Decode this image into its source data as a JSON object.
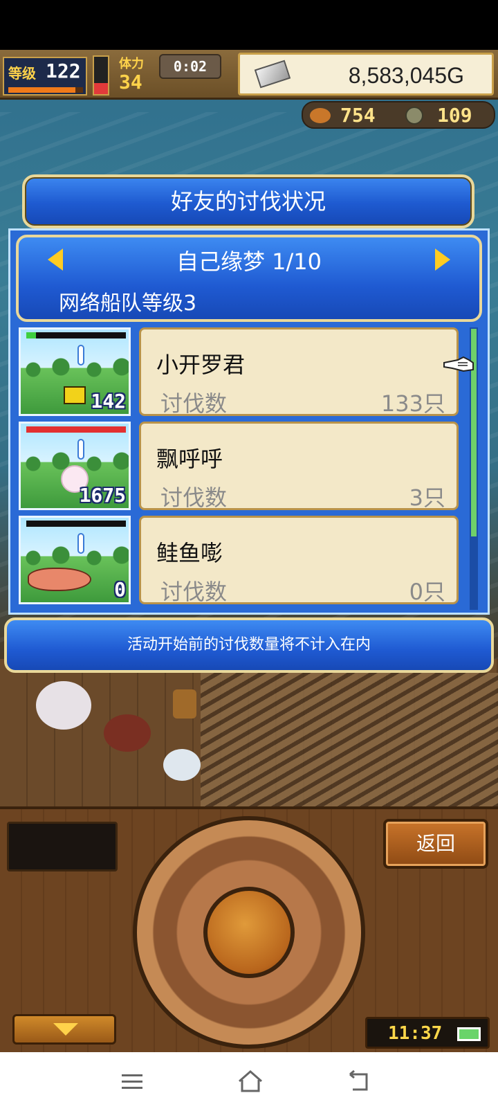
{
  "hud": {
    "level_label": "等级",
    "level_value": "122",
    "level_progress": 0.9,
    "hp_level": 0.3,
    "stamina_label": "体力",
    "stamina_value": "34",
    "timer": "0:02",
    "gold": "8,583,045G",
    "food": "754",
    "coins": "109"
  },
  "dialog": {
    "title": "好友的讨伐状况",
    "friend_name": "自己缘梦 1/10",
    "fleet_level": "网络船队等级3",
    "entries": [
      {
        "name": "小开罗君",
        "kill_label": "讨伐数",
        "kill_value": "133只",
        "thumb_count": "142",
        "hp_fraction": 0.1,
        "hp_color": "#3fcf3f",
        "monster_icon": "yellow-creature-icon"
      },
      {
        "name": "飘呼呼",
        "kill_label": "讨伐数",
        "kill_value": "3只",
        "thumb_count": "1675",
        "hp_fraction": 1.0,
        "hp_color": "#e23030",
        "monster_icon": "ghost-icon"
      },
      {
        "name": "鲑鱼嘭",
        "kill_label": "讨伐数",
        "kill_value": "0只",
        "thumb_count": "0",
        "hp_fraction": 0.0,
        "hp_color": "#e23030",
        "monster_icon": "salmon-icon"
      }
    ]
  },
  "notice": "活动开始前的讨伐数量将不计入在内",
  "controls": {
    "back_label": "返回",
    "clock": "11:37"
  },
  "colors": {
    "panel_blue": "#1f5ad2",
    "card_bg": "#f3e8c8",
    "gold_border": "#e9d89a"
  }
}
